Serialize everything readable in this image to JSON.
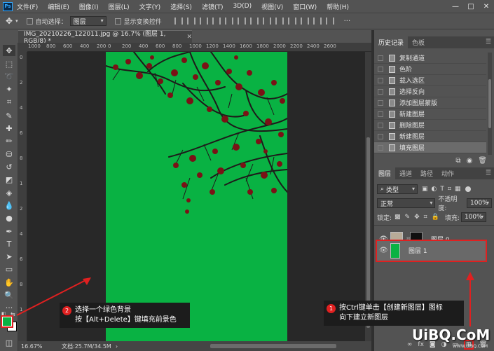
{
  "menu": {
    "logo": "Ps",
    "items": [
      "文件(F)",
      "编辑(E)",
      "图像(I)",
      "图层(L)",
      "文字(Y)",
      "选择(S)",
      "滤镜(T)",
      "3D(D)",
      "视图(V)",
      "窗口(W)",
      "帮助(H)"
    ]
  },
  "options": {
    "auto_select_label": "自动选择：",
    "auto_select_value": "图层",
    "show_transform_label": "显示变换控件"
  },
  "document": {
    "tab_title": "IMG_20210226_122011.jpg @ 16.7% (图层 1, RGB/8) *",
    "zoom": "16.67%",
    "doc_size": "文档:25.7M/34.5M"
  },
  "ruler": {
    "top_labels": [
      "1000",
      "800",
      "600",
      "400",
      "200",
      "0",
      "200",
      "400",
      "600",
      "800",
      "1000",
      "1200",
      "1400",
      "1600",
      "1800",
      "2000",
      "2200",
      "2400",
      "2600"
    ],
    "left_labels": [
      "0",
      "2",
      "4",
      "6",
      "8",
      "1",
      "2",
      "4",
      "6",
      "8",
      "1"
    ]
  },
  "history": {
    "tabs": [
      "历史记录",
      "色板"
    ],
    "items": [
      "复制通道",
      "色阶",
      "载入选区",
      "选择反向",
      "添加图层蒙版",
      "新建图层",
      "删除图层",
      "新建图层",
      "填充图层"
    ],
    "selected_index": 8
  },
  "layers": {
    "tabs": [
      "图层",
      "通道",
      "路径",
      "动作"
    ],
    "filter_label": "类型",
    "blend_mode": "正常",
    "opacity_label": "不透明度:",
    "opacity_value": "100%",
    "lock_label": "锁定:",
    "fill_label": "填充:",
    "fill_value": "100%",
    "items": [
      {
        "name": "图层 0",
        "selected": false
      },
      {
        "name": "图层 1",
        "selected": true
      }
    ]
  },
  "annotations": [
    {
      "number": "1",
      "line1": "按Ctrl键单击【创建新图层】图标",
      "line2": "向下建立新图层"
    },
    {
      "number": "2",
      "line1": "选择一个绿色背景",
      "line2": "按【Alt+Delete】键填充前景色"
    }
  ],
  "watermark": {
    "text": "UiBQ.CoM",
    "sub": "WWW.UIBQ.COM"
  },
  "colors": {
    "canvas_green": "#09b243",
    "foreground_swatch": "#09b243",
    "highlight_red": "#e02020"
  }
}
